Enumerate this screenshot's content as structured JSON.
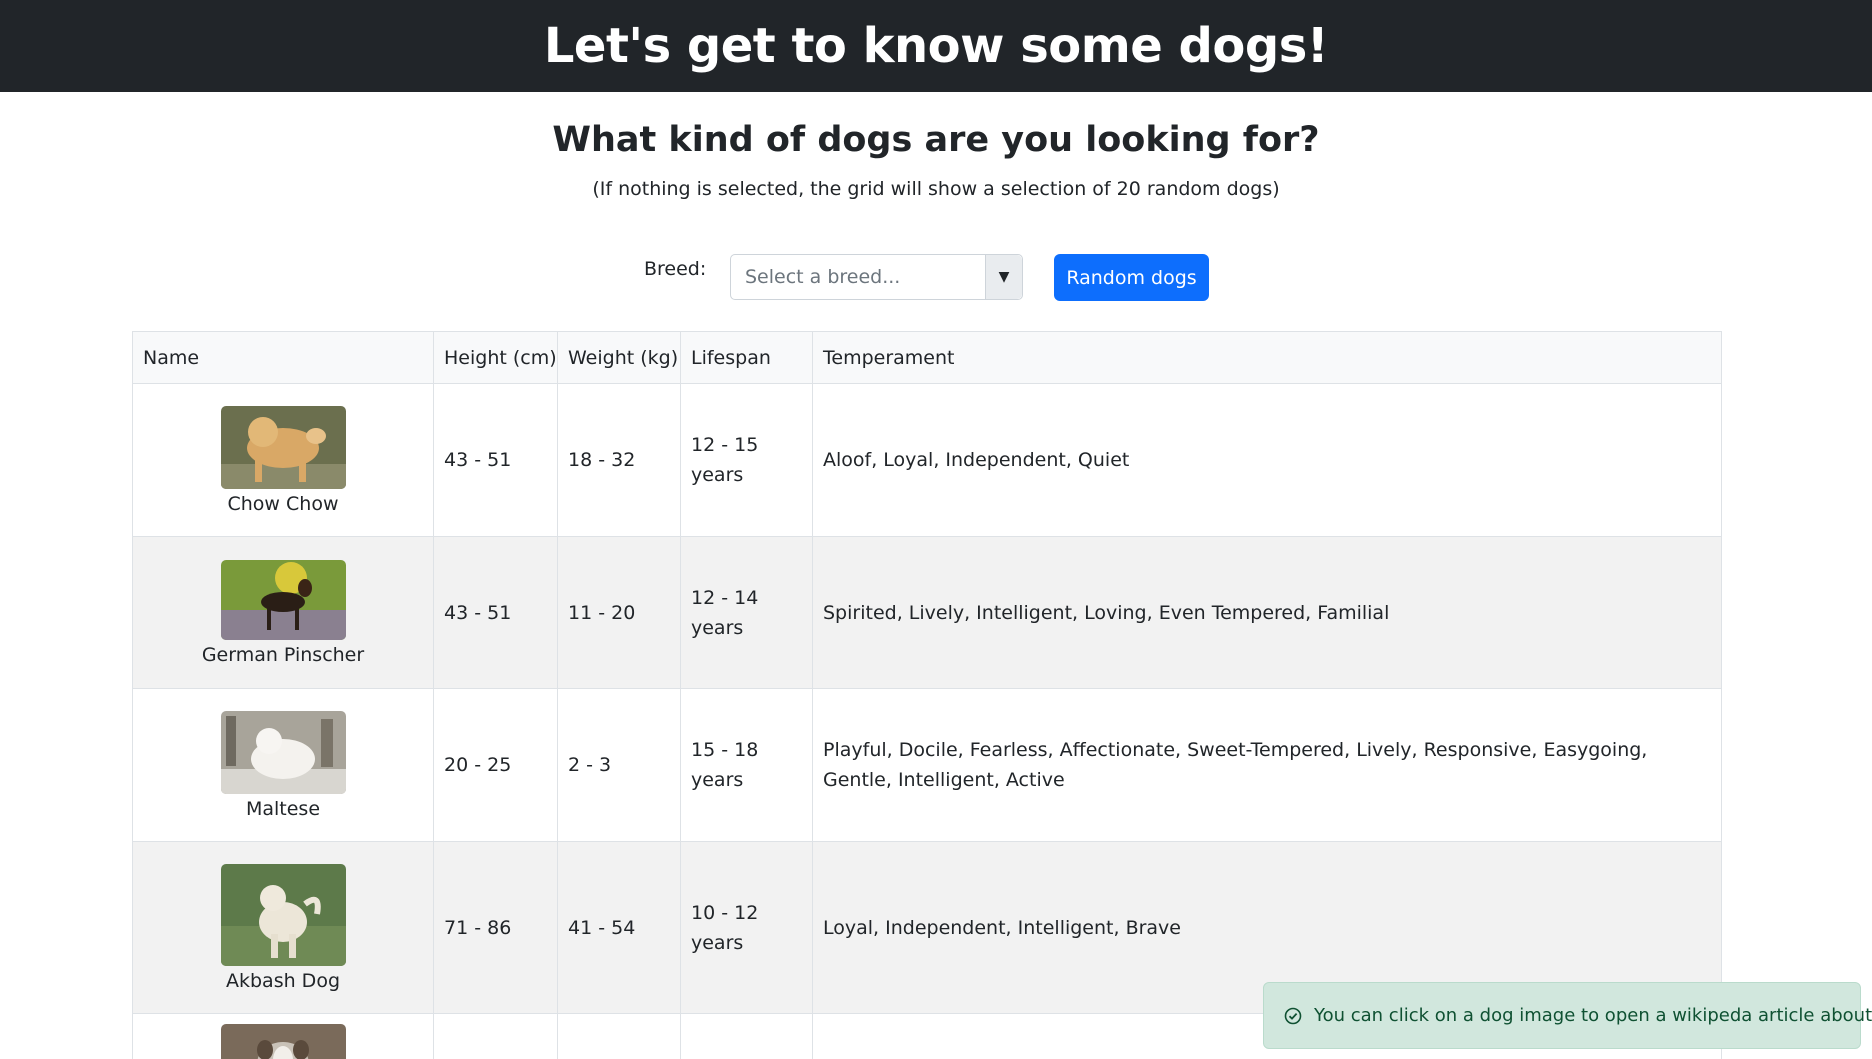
{
  "header": {
    "title": "Let's get to know some dogs!"
  },
  "intro": {
    "heading": "What kind of dogs are you looking for?",
    "subheading": "(If nothing is selected, the grid will show a selection of 20 random dogs)"
  },
  "filter": {
    "breed_label": "Breed:",
    "breed_placeholder": "Select a breed...",
    "random_button": "Random dogs"
  },
  "table": {
    "columns": [
      "Name",
      "Height (cm)",
      "Weight (kg)",
      "Lifespan",
      "Temperament"
    ],
    "rows": [
      {
        "name": "Chow Chow",
        "height": "43 - 51",
        "weight": "18 - 32",
        "lifespan": "12 - 15 years",
        "temperament": "Aloof, Loyal, Independent, Quiet"
      },
      {
        "name": "German Pinscher",
        "height": "43 - 51",
        "weight": "11 - 20",
        "lifespan": "12 - 14 years",
        "temperament": "Spirited, Lively, Intelligent, Loving, Even Tempered, Familial"
      },
      {
        "name": "Maltese",
        "height": "20 - 25",
        "weight": "2 - 3",
        "lifespan": "15 - 18 years",
        "temperament": "Playful, Docile, Fearless, Affectionate, Sweet-Tempered, Lively, Responsive, Easygoing, Gentle, Intelligent, Active"
      },
      {
        "name": "Akbash Dog",
        "height": "71 - 86",
        "weight": "41 - 54",
        "lifespan": "10 - 12 years",
        "temperament": "Loyal, Independent, Intelligent, Brave"
      }
    ]
  },
  "toast": {
    "message": "You can click on a dog image to open a wikipeda article about it!",
    "close": "✕"
  },
  "colors": {
    "topbar": "#212529",
    "primary": "#0d6efd",
    "toast_bg": "#d1e7dd",
    "toast_text": "#0f5132"
  }
}
